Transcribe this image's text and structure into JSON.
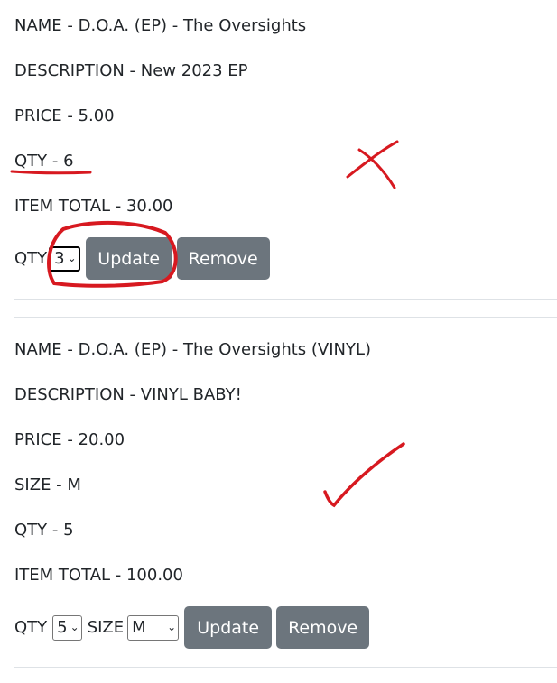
{
  "items": [
    {
      "name": "NAME - D.O.A. (EP) - The Oversights",
      "description": "DESCRIPTION - New 2023 EP",
      "price": "PRICE - 5.00",
      "qty": "QTY - 6",
      "item_total": "ITEM TOTAL - 30.00",
      "controls": {
        "qty_label": "QTY",
        "qty_value": "3",
        "update_label": "Update",
        "remove_label": "Remove"
      }
    },
    {
      "name": "NAME - D.O.A. (EP) - The Oversights (VINYL)",
      "description": "DESCRIPTION - VINYL BABY!",
      "price": "PRICE - 20.00",
      "size": "SIZE - M",
      "qty": "QTY - 5",
      "item_total": "ITEM TOTAL - 100.00",
      "controls": {
        "qty_label": "QTY",
        "qty_value": "5",
        "size_label": "SIZE",
        "size_value": "M",
        "update_label": "Update",
        "remove_label": "Remove"
      }
    }
  ],
  "colors": {
    "button_bg": "#6c757d",
    "annotation": "#d71920",
    "divider": "#dee2e6"
  }
}
